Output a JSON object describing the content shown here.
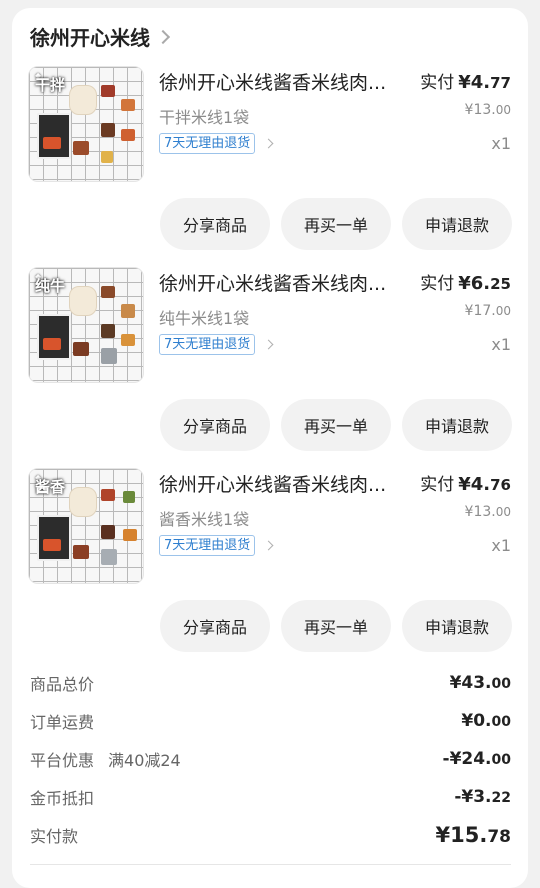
{
  "shop": {
    "name": "徐州开心米线"
  },
  "items": [
    {
      "title": "徐州开心米线酱香米线肉...",
      "spec": "干拌米线1袋",
      "badge": "7天无理由退货",
      "paid_label": "实付",
      "paid_int": "¥4.",
      "paid_dec": "77",
      "orig_int": "¥13.",
      "orig_dec": "00",
      "qty": "x1",
      "thumb_label": "干拌"
    },
    {
      "title": "徐州开心米线酱香米线肉...",
      "spec": "纯牛米线1袋",
      "badge": "7天无理由退货",
      "paid_label": "实付",
      "paid_int": "¥6.",
      "paid_dec": "25",
      "orig_int": "¥17.",
      "orig_dec": "00",
      "qty": "x1",
      "thumb_label": "纯牛"
    },
    {
      "title": "徐州开心米线酱香米线肉...",
      "spec": "酱香米线1袋",
      "badge": "7天无理由退货",
      "paid_label": "实付",
      "paid_int": "¥4.",
      "paid_dec": "76",
      "orig_int": "¥13.",
      "orig_dec": "00",
      "qty": "x1",
      "thumb_label": "酱香"
    }
  ],
  "actions": {
    "share": "分享商品",
    "rebuy": "再买一单",
    "refund": "申请退款"
  },
  "summary": {
    "goods_total_label": "商品总价",
    "goods_total_int": "¥43.",
    "goods_total_dec": "00",
    "shipping_label": "订单运费",
    "shipping_int": "¥0.",
    "shipping_dec": "00",
    "discount_label": "平台优惠",
    "discount_promo": "满40减24",
    "discount_int": "-¥24.",
    "discount_dec": "00",
    "coins_label": "金币抵扣",
    "coins_int": "-¥3.",
    "coins_dec": "22",
    "paid_label": "实付款",
    "paid_int": "¥15.",
    "paid_dec": "78"
  },
  "colors": {
    "badge_blue": "#2f7fcf",
    "button_bg": "#f2f2f2",
    "card_bg": "#ffffff",
    "page_bg": "#f1f1f1"
  }
}
